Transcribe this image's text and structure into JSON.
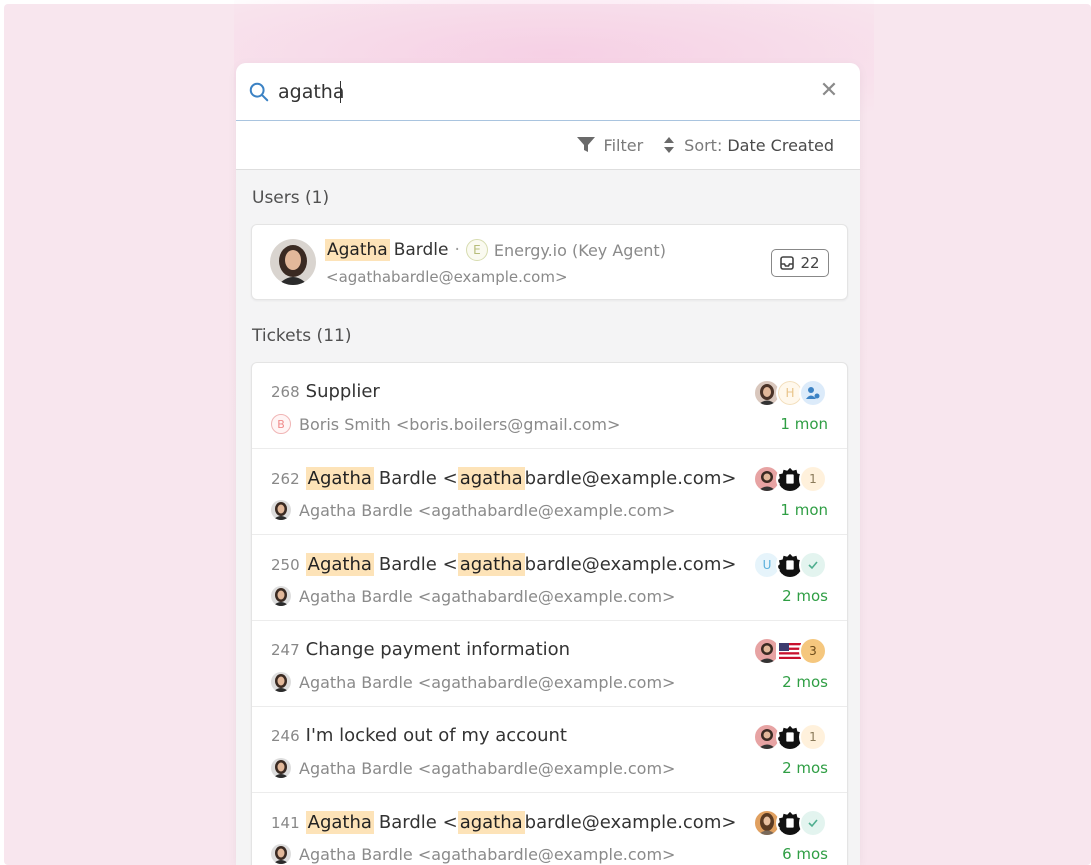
{
  "search": {
    "query": "agatha"
  },
  "toolbar": {
    "filter_label": "Filter",
    "sort_label": "Sort:",
    "sort_value": "Date Created"
  },
  "users": {
    "title": "Users (1)",
    "items": [
      {
        "first_highlight": "Agatha",
        "rest_name": "Bardle",
        "org_initial": "E",
        "org": "Energy.io (Key Agent)",
        "email": "<agathabardle@example.com>",
        "ticket_count": "22"
      }
    ]
  },
  "tickets": {
    "title": "Tickets (11)",
    "items": [
      {
        "id": "268",
        "title": "Supplier",
        "requester": "Boris Smith <boris.boilers@gmail.com>",
        "requester_initial": "B",
        "age": "1 mon",
        "icons": [
          "agent-avatar-icon",
          "h-initial-icon",
          "assign-user-icon"
        ]
      },
      {
        "id": "262",
        "hl1": "Agatha",
        "mid": "Bardle <",
        "hl2": "agatha",
        "tail": "bardle@example.com>",
        "requester": "Agatha Bardle <agathabardle@example.com>",
        "age": "1 mon",
        "count": "1"
      },
      {
        "id": "250",
        "hl1": "Agatha",
        "mid": "Bardle <",
        "hl2": "agatha",
        "tail": "bardle@example.com>",
        "requester": "Agatha Bardle <agathabardle@example.com>",
        "age": "2 mos",
        "u_initial": "U"
      },
      {
        "id": "247",
        "title": "Change payment information",
        "requester": "Agatha Bardle <agathabardle@example.com>",
        "age": "2 mos",
        "count": "3"
      },
      {
        "id": "246",
        "title": "I'm locked out of my account",
        "requester": "Agatha Bardle <agathabardle@example.com>",
        "age": "2 mos",
        "count": "1"
      },
      {
        "id": "141",
        "hl1": "Agatha",
        "mid": "Bardle <",
        "hl2": "agatha",
        "tail": "bardle@example.com>",
        "requester": "Agatha Bardle <agathabardle@example.com>",
        "age": "6 mos"
      }
    ]
  },
  "colors": {
    "accent": "#3b82c4",
    "highlight": "#fde3b8",
    "age_green": "#2f9e44"
  }
}
